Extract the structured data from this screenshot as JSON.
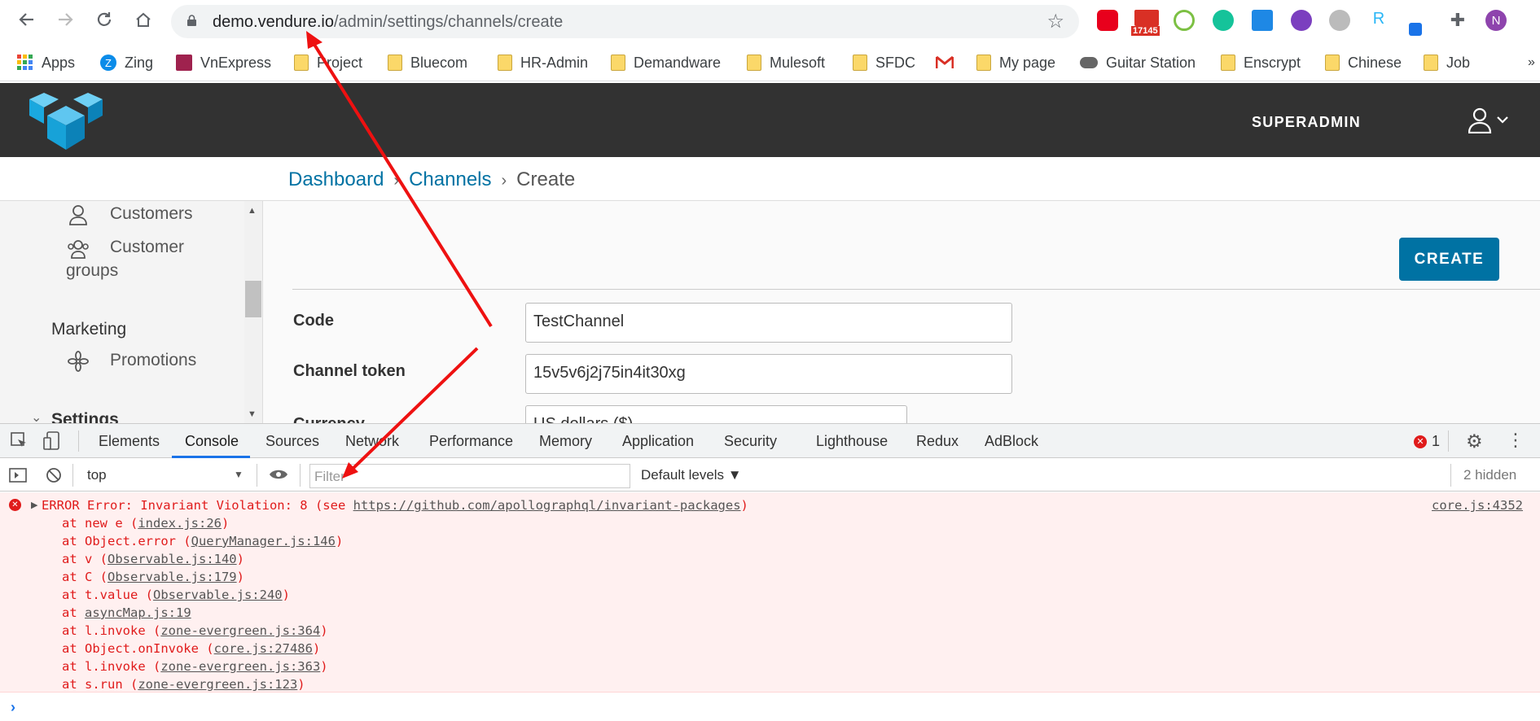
{
  "browser": {
    "url_host": "demo.vendure.io",
    "url_path": "/admin/settings/channels/create",
    "badge_count": "17145",
    "profile_initial": "N",
    "bookmarks": [
      {
        "label": "Apps"
      },
      {
        "label": "Zing"
      },
      {
        "label": "VnExpress"
      },
      {
        "label": "Project"
      },
      {
        "label": "Bluecom"
      },
      {
        "label": "HR-Admin"
      },
      {
        "label": "Demandware"
      },
      {
        "label": "Mulesoft"
      },
      {
        "label": "SFDC"
      },
      {
        "label": "My page"
      },
      {
        "label": "Guitar Station"
      },
      {
        "label": "Enscrypt"
      },
      {
        "label": "Chinese"
      },
      {
        "label": "Job"
      }
    ],
    "more_bookmarks": "»"
  },
  "header": {
    "user_label": "SUPERADMIN"
  },
  "breadcrumb": {
    "items": [
      "Dashboard",
      "Channels",
      "Create"
    ],
    "separator": "›"
  },
  "sidebar": {
    "customers": "Customers",
    "customer_groups_1": "Customer",
    "customer_groups_2": "groups",
    "marketing": "Marketing",
    "promotions": "Promotions",
    "settings": "Settings"
  },
  "form": {
    "create_label": "CREATE",
    "code_label": "Code",
    "code_value": "TestChannel",
    "token_label": "Channel token",
    "token_value": "15v5v6j2j75in4it30xg",
    "currency_label": "Currency",
    "currency_value": "US dollars ($)"
  },
  "devtools": {
    "tabs": [
      "Elements",
      "Console",
      "Sources",
      "Network",
      "Performance",
      "Memory",
      "Application",
      "Security",
      "Lighthouse",
      "Redux",
      "AdBlock"
    ],
    "error_count": "1",
    "context": "top",
    "filter_placeholder": "Filter",
    "levels": "Default levels ▼",
    "hidden": "2 hidden",
    "error_head": "ERROR Error: Invariant Violation: 8 (see ",
    "error_link": "https://github.com/apollographql/invariant-packages",
    "error_tail": ")",
    "error_source": "core.js:4352",
    "stack": [
      {
        "pre": "at new e (",
        "file": "index.js:26",
        "post": ")"
      },
      {
        "pre": "at Object.error (",
        "file": "QueryManager.js:146",
        "post": ")"
      },
      {
        "pre": "at v (",
        "file": "Observable.js:140",
        "post": ")"
      },
      {
        "pre": "at C (",
        "file": "Observable.js:179",
        "post": ")"
      },
      {
        "pre": "at t.value (",
        "file": "Observable.js:240",
        "post": ")"
      },
      {
        "pre": "at ",
        "file": "asyncMap.js:19",
        "post": ""
      },
      {
        "pre": "at l.invoke (",
        "file": "zone-evergreen.js:364",
        "post": ")"
      },
      {
        "pre": "at Object.onInvoke (",
        "file": "core.js:27486",
        "post": ")"
      },
      {
        "pre": "at l.invoke (",
        "file": "zone-evergreen.js:363",
        "post": ")"
      },
      {
        "pre": "at s.run (",
        "file": "zone-evergreen.js:123",
        "post": ")"
      }
    ],
    "prompt": "›"
  },
  "colors": {
    "vendure_blue": "#0072a3",
    "header_dark": "#323232",
    "annotation_red": "#ee1111",
    "error_red": "#e01b1b"
  }
}
